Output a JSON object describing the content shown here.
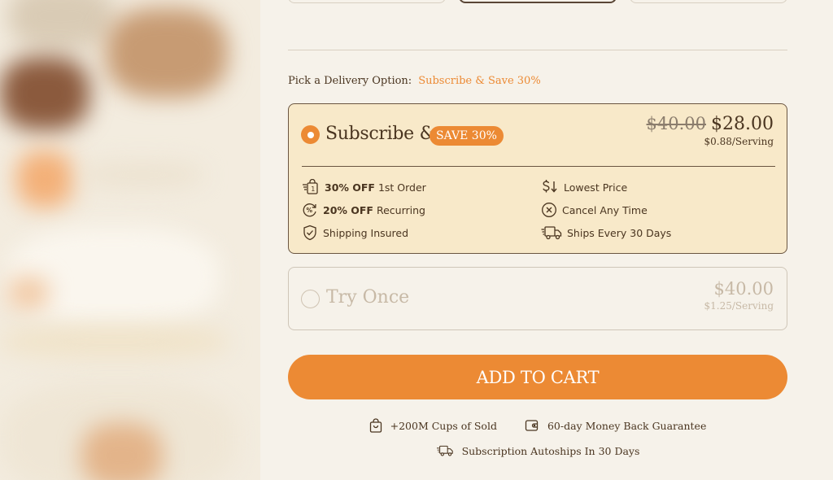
{
  "delivery": {
    "label": "Pick a Delivery Option:",
    "promo": "Subscribe & Save 30%"
  },
  "subscribe": {
    "title": "Subscribe &",
    "badge": "SAVE 30%",
    "old_price": "$40.00",
    "new_price": "$28.00",
    "per_serving": "$0.88/Serving",
    "selected": true,
    "features": [
      {
        "bold": "30% OFF",
        "text": " 1st Order",
        "icon": "shopping-bag-icon"
      },
      {
        "bold": "20% OFF",
        "text": " Recurring",
        "icon": "percent-cycle-icon"
      },
      {
        "bold": "",
        "text": "Shipping Insured",
        "icon": "shield-check-icon"
      },
      {
        "bold": "",
        "text": "Lowest Price",
        "icon": "dollar-down-icon"
      },
      {
        "bold": "",
        "text": "Cancel Any Time",
        "icon": "cancel-circle-icon"
      },
      {
        "bold": "",
        "text": "Ships Every 30 Days",
        "icon": "delivery-truck-icon"
      }
    ]
  },
  "try_once": {
    "title": "Try Once",
    "price": "$40.00",
    "per_serving": "$1.25/Serving",
    "selected": false
  },
  "cart": {
    "button_label": "ADD TO CART"
  },
  "trust": {
    "cups_sold": "+200M Cups of Sold",
    "guarantee": "60-day Money Back Guarantee",
    "autoship": "Subscription Autoships In 30 Days"
  },
  "colors": {
    "accent": "#ec8a34",
    "text": "#4a3520",
    "card_bg": "#f8e9c9",
    "page_bg": "#f6f2ea"
  }
}
